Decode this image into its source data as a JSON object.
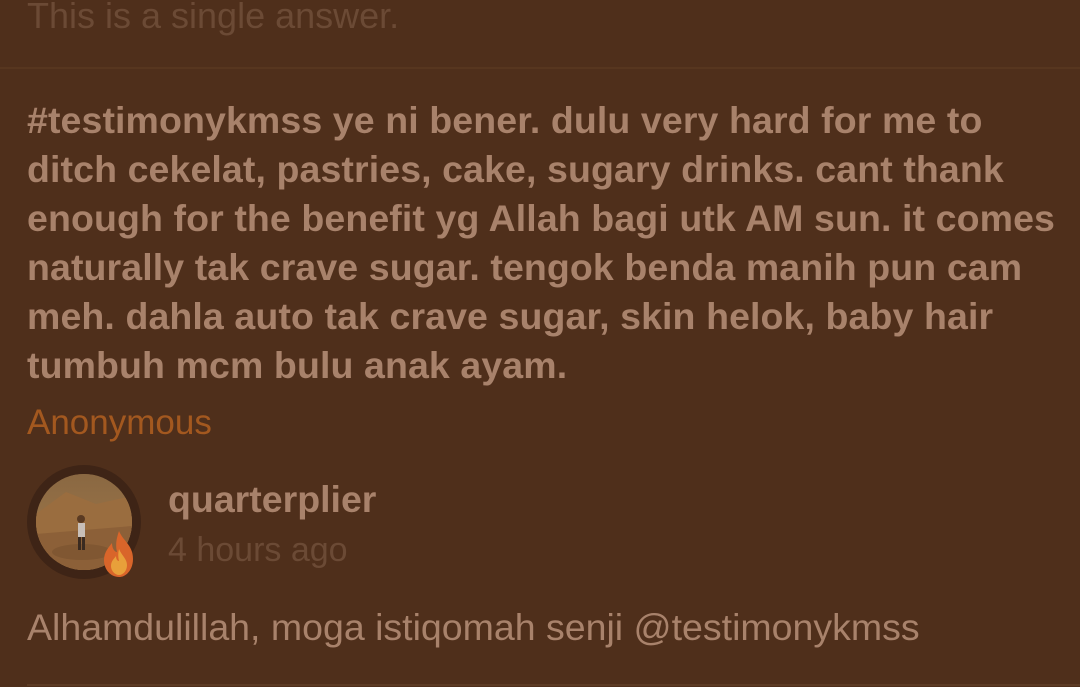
{
  "header": {
    "note": "This is a single answer."
  },
  "question": {
    "text": "#testimonykmss ye ni bener. dulu very hard for me to ditch cekelat, pastries, cake, sugary drinks. cant thank enough for the benefit yg Allah bagi utk AM sun. it comes naturally tak crave sugar. tengok benda manih pun cam meh. dahla auto tak crave sugar, skin helok, baby hair tumbuh mcm bulu anak ayam.",
    "asker": "Anonymous"
  },
  "answer": {
    "username": "quarterplier",
    "time": "4 hours ago",
    "text": "Alhamdulillah, moga istiqomah senji @testimonykmss",
    "avatar_icon": "user-avatar-photo",
    "badge_icon": "fire-icon"
  },
  "colors": {
    "background": "#4f2f1b",
    "text": "#a8826b",
    "muted": "#6b4a35",
    "accent": "#a3581f"
  }
}
